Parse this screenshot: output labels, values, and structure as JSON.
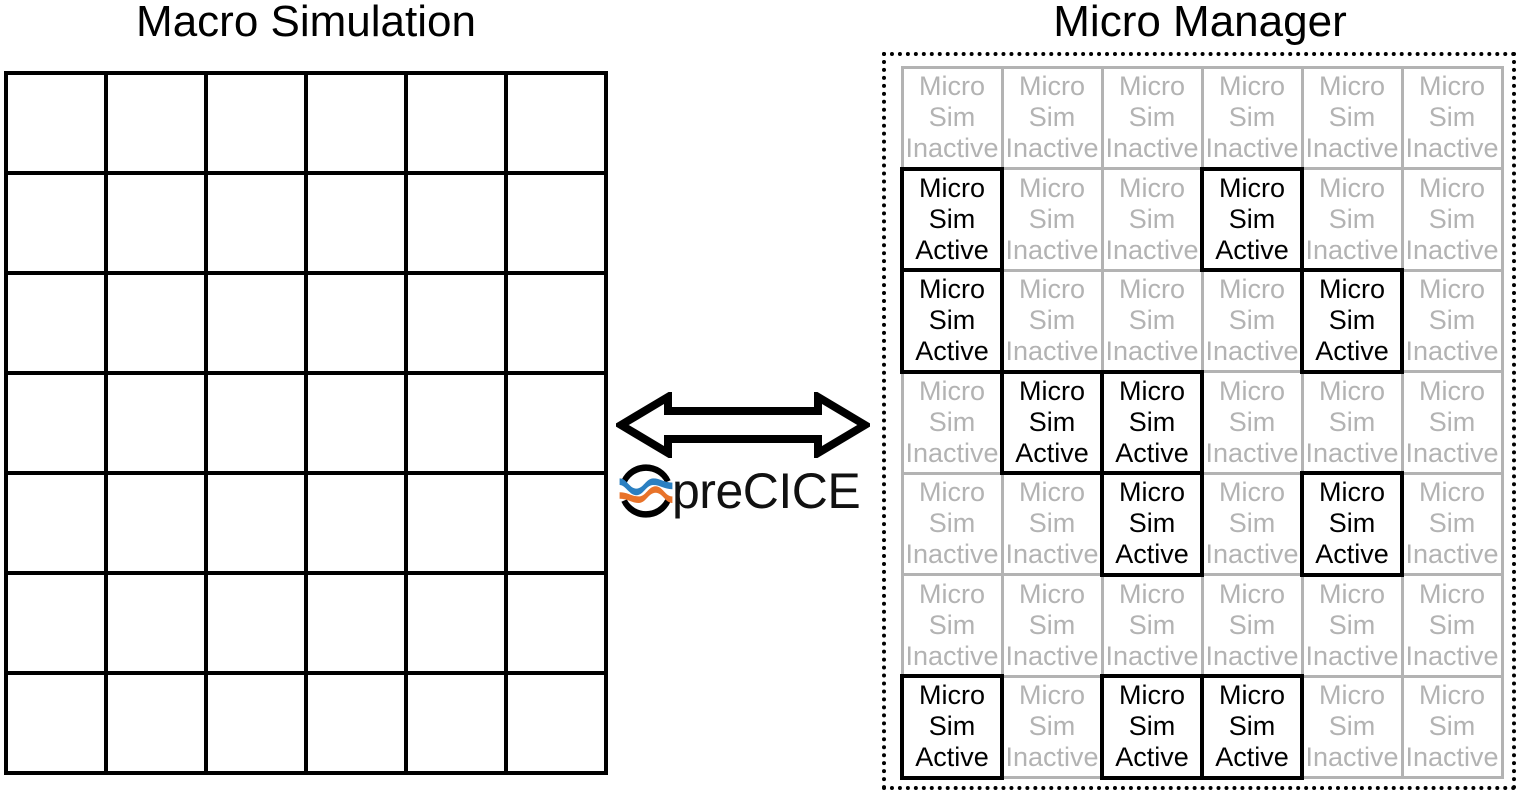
{
  "macro": {
    "title": "Macro Simulation",
    "grid": {
      "columns": 6,
      "rows": 7
    }
  },
  "coupling": {
    "arrow_icon": "double-headed-horizontal-arrow",
    "logo_mark_icon": "precice-wave-circle-logo",
    "logo_text": "preCICE",
    "colors": {
      "wave_top": "#2a7fc1",
      "wave_bottom": "#e8732a",
      "arc": "#000000",
      "arrow_outline": "#000000",
      "arrow_fill": "#ffffff"
    }
  },
  "micro": {
    "title": "Micro Manager",
    "grid": {
      "columns": 6,
      "rows": 7
    },
    "labels": {
      "line1": "Micro",
      "line2": "Sim",
      "active": "Active",
      "inactive": "Inactive"
    },
    "colors": {
      "active_border": "#000000",
      "active_text": "#000000",
      "inactive_border": "#b3b3b3",
      "inactive_text": "#b3b3b3",
      "container_border": "#000000"
    },
    "states": [
      [
        "inactive",
        "inactive",
        "inactive",
        "inactive",
        "inactive",
        "inactive"
      ],
      [
        "active",
        "inactive",
        "inactive",
        "active",
        "inactive",
        "inactive"
      ],
      [
        "active",
        "inactive",
        "inactive",
        "inactive",
        "active",
        "inactive"
      ],
      [
        "inactive",
        "active",
        "active",
        "inactive",
        "inactive",
        "inactive"
      ],
      [
        "inactive",
        "inactive",
        "active",
        "inactive",
        "active",
        "inactive"
      ],
      [
        "inactive",
        "inactive",
        "inactive",
        "inactive",
        "inactive",
        "inactive"
      ],
      [
        "active",
        "inactive",
        "active",
        "active",
        "inactive",
        "inactive"
      ]
    ],
    "active_count": 9,
    "inactive_count": 33
  }
}
